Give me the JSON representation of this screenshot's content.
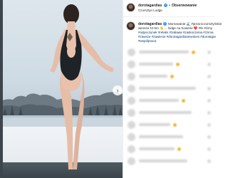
{
  "post": {
    "username": "dorotagardias",
    "follow_label": "Obserwowanie",
    "location": "Czorsztyn Lodge",
    "caption_lines": [
      "Morsowanie 🌊 #jezioroczorsztyńskie",
      "wiersze 10 km 👋 ... lodge na Sowerie ❤️ #fe #zimy",
      "#odpoczynek #relaks #zabawa #zaskoczenia #zzima",
      "#zawsze #zawiecie #dorotagardiasewolves #dorotagar",
      "#wspólpraca"
    ]
  },
  "comments": [
    {
      "id": "c1"
    },
    {
      "id": "c2"
    },
    {
      "id": "c3"
    },
    {
      "id": "c4"
    },
    {
      "id": "c5"
    },
    {
      "id": "c6"
    },
    {
      "id": "c7"
    },
    {
      "id": "c8"
    },
    {
      "id": "c9"
    },
    {
      "id": "c10"
    }
  ],
  "icons": {
    "verified": "verified-badge-icon",
    "next": "chevron-right-icon"
  },
  "colors": {
    "accent": "#3897f0",
    "hashtag": "#003569",
    "text": "#262626"
  }
}
